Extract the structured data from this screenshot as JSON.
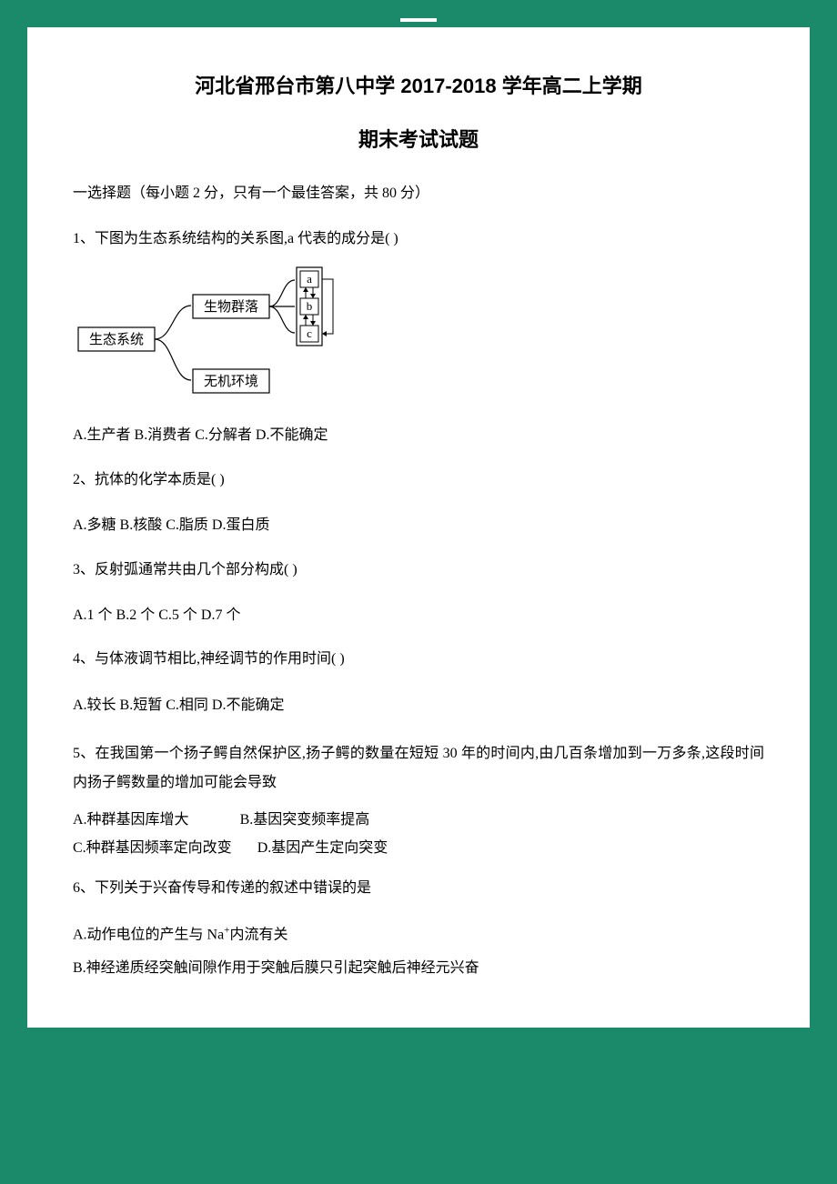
{
  "title_line1": "河北省邢台市第八中学 2017-2018 学年高二上学期",
  "title_line2": "期末考试试题",
  "instruction": "一选择题（每小题 2 分，只有一个最佳答案，共 80 分）",
  "diagram": {
    "root": "生态系统",
    "branch1": "生物群落",
    "branch2": "无机环境",
    "nodes": {
      "a": "a",
      "b": "b",
      "c": "c"
    }
  },
  "q1": {
    "text": "1、下图为生态系统结构的关系图,a 代表的成分是(    )",
    "options": "A.生产者        B.消费者       C.分解者     D.不能确定"
  },
  "q2": {
    "text": "2、抗体的化学本质是(    )",
    "options": "A.多糖       B.核酸       C.脂质         D.蛋白质"
  },
  "q3": {
    "text": "3、反射弧通常共由几个部分构成(    )",
    "options": "A.1 个       B.2 个       C.5 个       D.7 个"
  },
  "q4": {
    "text": "4、与体液调节相比,神经调节的作用时间(    )",
    "options": "A.较长 B.短暂 C.相同 D.不能确定"
  },
  "q5": {
    "text": "5、在我国第一个扬子鳄自然保护区,扬子鳄的数量在短短 30 年的时间内,由几百条增加到一万多条,这段时间内扬子鳄数量的增加可能会导致",
    "optA": "A.种群基因库增大",
    "optB": "B.基因突变频率提高",
    "optC": "C.种群基因频率定向改变",
    "optD": "D.基因产生定向突变"
  },
  "q6": {
    "text": "6、下列关于兴奋传导和传递的叙述中错误的是",
    "optA_pre": "A.动作电位的产生与 Na",
    "optA_post": "内流有关",
    "optB": "B.神经递质经突触间隙作用于突触后膜只引起突触后神经元兴奋"
  }
}
